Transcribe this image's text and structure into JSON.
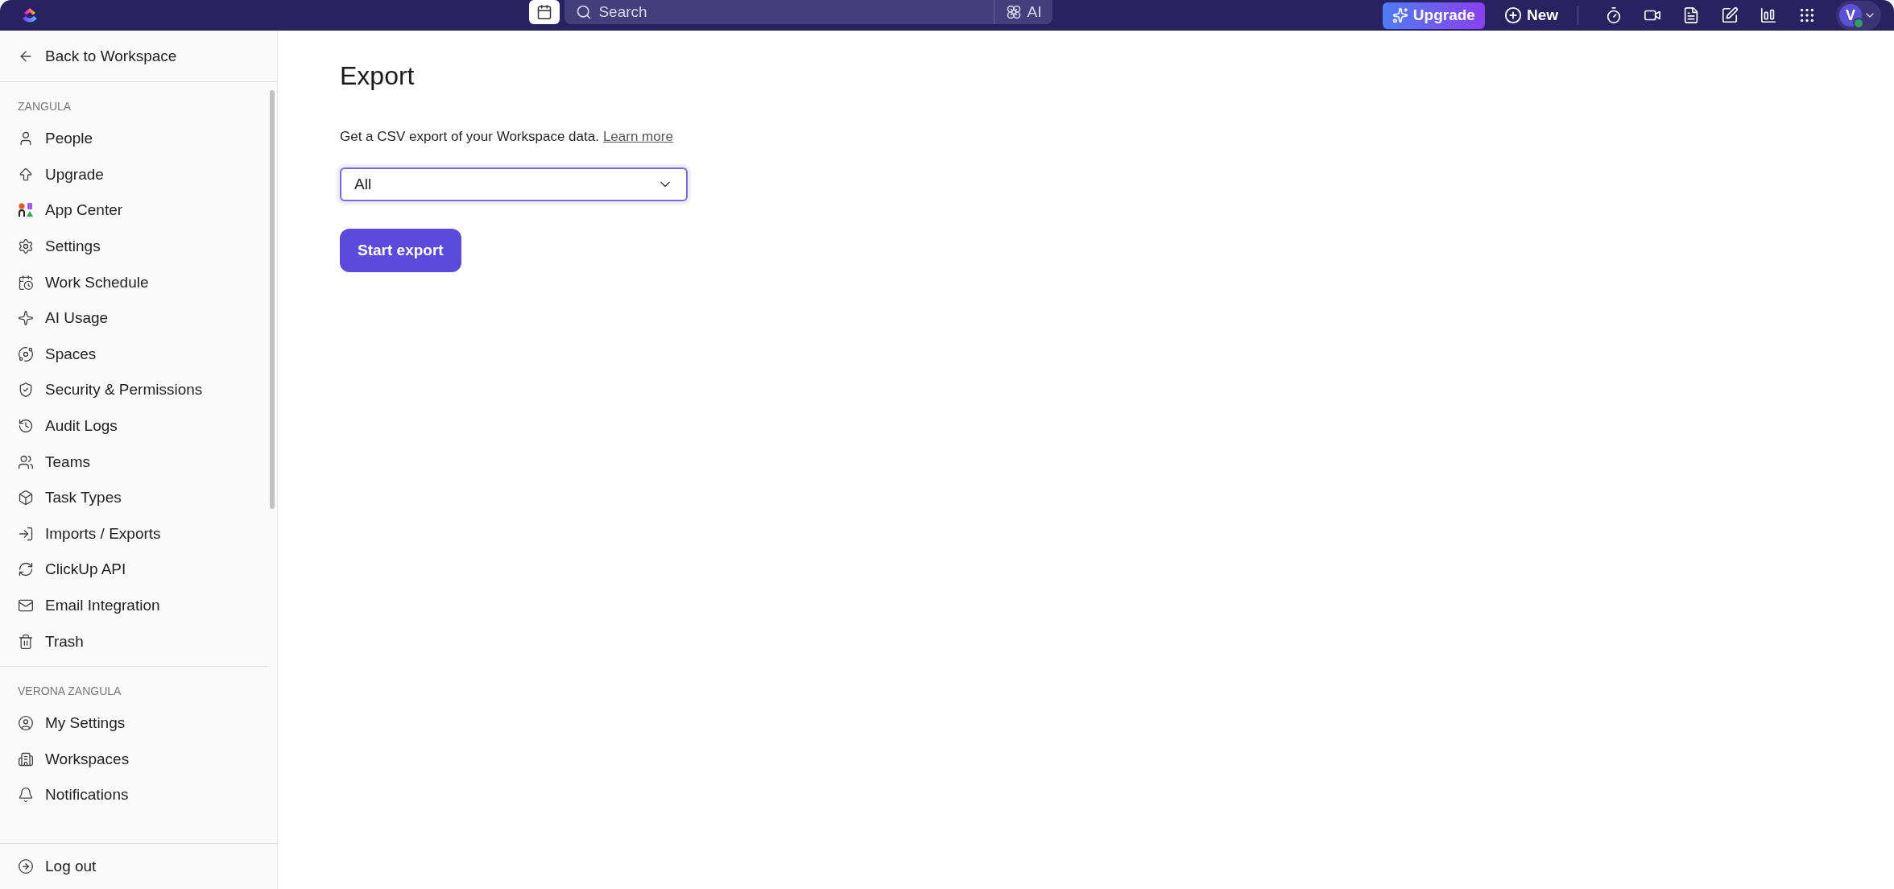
{
  "top_bar": {
    "search": {
      "placeholder": "Search"
    },
    "ai_label": "AI",
    "upgrade": "Upgrade",
    "new": "New",
    "avatar": "V"
  },
  "sidebar": {
    "back": "Back to Workspace",
    "sections": [
      {
        "title": "ZANGULA",
        "items": [
          "People",
          "Upgrade",
          "App Center",
          "Settings",
          "Work Schedule",
          "AI Usage",
          "Spaces",
          "Security & Permissions",
          "Audit Logs",
          "Teams",
          "Task Types",
          "Imports / Exports",
          "ClickUp API",
          "Email Integration",
          "Trash"
        ]
      },
      {
        "title": "VERONA ZANGULA",
        "items": [
          "My Settings",
          "Workspaces",
          "Notifications"
        ]
      }
    ],
    "logout": "Log out"
  },
  "main": {
    "title": "Export",
    "description": "Get a CSV export of your Workspace data.",
    "link": "Learn more",
    "select": {
      "value": "All"
    },
    "button": "Start export"
  }
}
